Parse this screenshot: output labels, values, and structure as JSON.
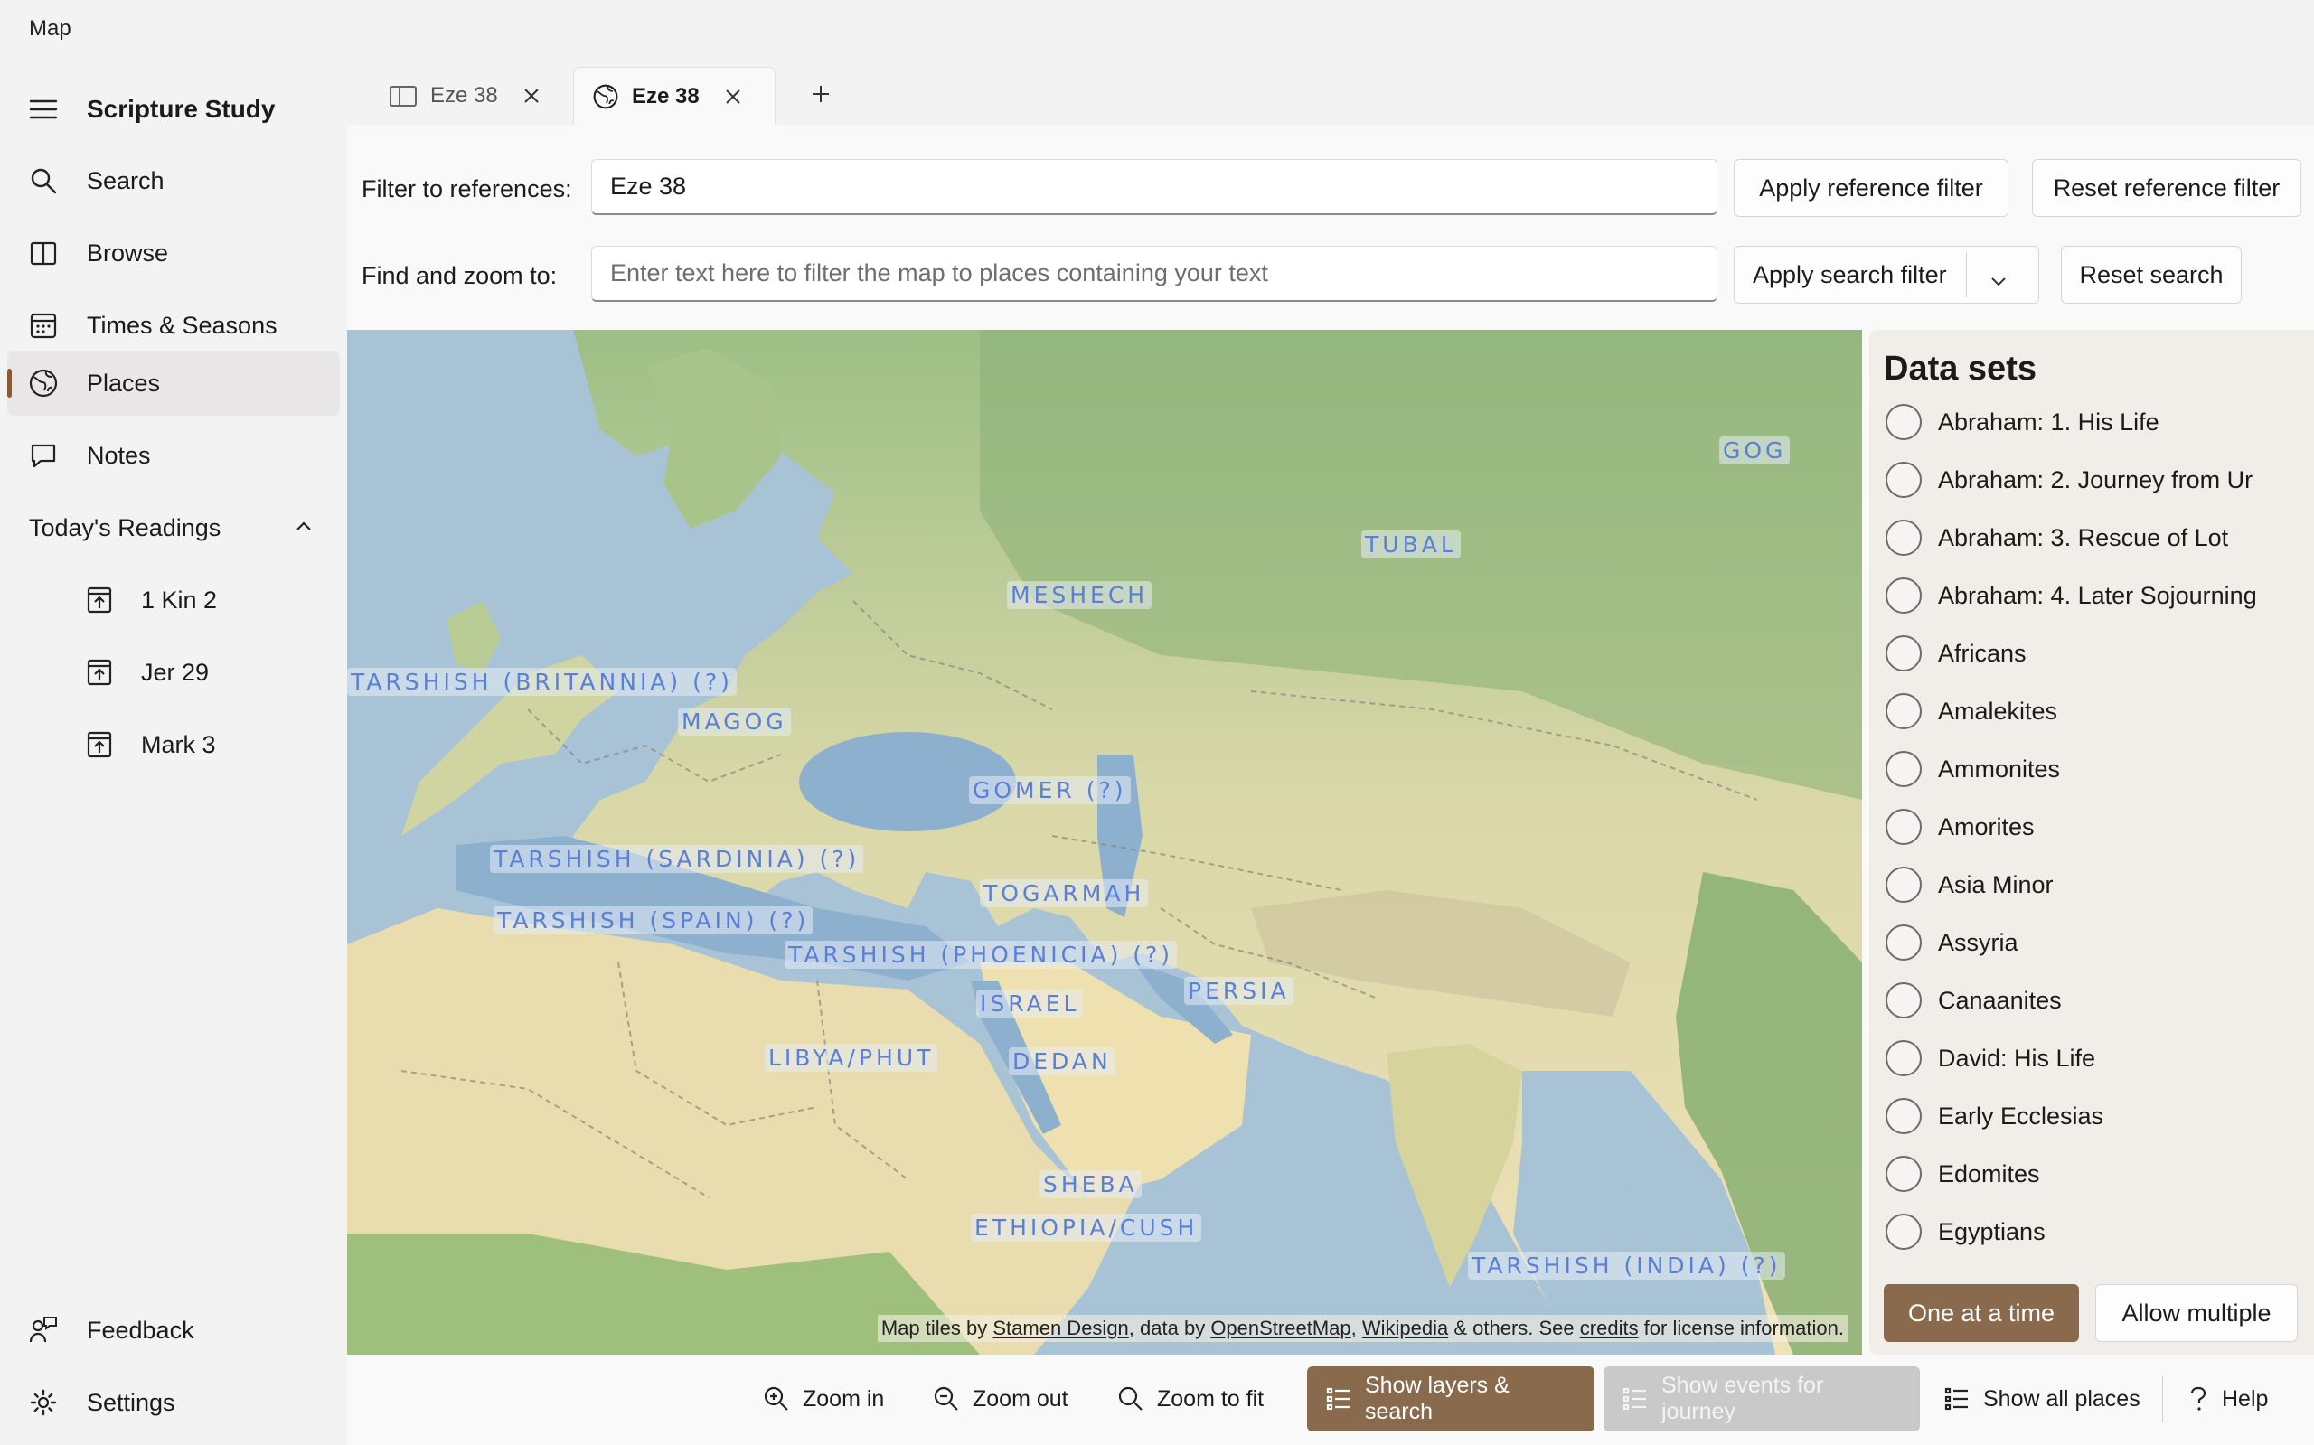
{
  "window": {
    "title": "Map"
  },
  "sidebar": {
    "app_name": "Scripture Study",
    "items": [
      {
        "label": "Search",
        "icon": "search-icon"
      },
      {
        "label": "Browse",
        "icon": "book-icon"
      },
      {
        "label": "Times & Seasons",
        "icon": "calendar-icon"
      },
      {
        "label": "Places",
        "icon": "globe-icon",
        "active": true
      },
      {
        "label": "Notes",
        "icon": "comment-icon"
      }
    ],
    "readings_header": "Today's Readings",
    "readings": [
      "1 Kin 2",
      "Jer 29",
      "Mark 3"
    ],
    "footer": [
      {
        "label": "Feedback",
        "icon": "feedback-icon"
      },
      {
        "label": "Settings",
        "icon": "gear-icon"
      }
    ]
  },
  "tabs": [
    {
      "label": "Eze 38",
      "icon": "book-icon",
      "active": false
    },
    {
      "label": "Eze 38",
      "icon": "globe-icon",
      "active": true
    }
  ],
  "filters": {
    "reference_label": "Filter to references:",
    "reference_value": "Eze 38",
    "apply_reference": "Apply reference filter",
    "reset_reference": "Reset reference filter",
    "find_label": "Find and zoom to:",
    "find_placeholder": "Enter text here to filter the map to places containing your text",
    "apply_search": "Apply search filter",
    "reset_search": "Reset search"
  },
  "map": {
    "places": [
      "GOG",
      "TUBAL",
      "MESHECH",
      "TARSHISH (BRITANNIA) (?)",
      "MAGOG",
      "GOMER (?)",
      "TARSHISH (SARDINIA) (?)",
      "TOGARMAH",
      "TARSHISH (SPAIN) (?)",
      "TARSHISH (PHOENICIA) (?)",
      "PERSIA",
      "ISRAEL",
      "LIBYA/PHUT",
      "DEDAN",
      "SHEBA",
      "ETHIOPIA/CUSH",
      "TARSHISH (INDIA) (?)"
    ],
    "attribution": {
      "prefix": "Map tiles by ",
      "stamen": "Stamen Design",
      "mid1": ", data by ",
      "osm": "OpenStreetMap",
      "comma": ", ",
      "wiki": "Wikipedia",
      "mid2": " & others. See ",
      "credits": "credits",
      "suffix": " for license information."
    }
  },
  "datasets": {
    "title": "Data sets",
    "items": [
      "Abraham: 1. His Life",
      "Abraham: 2. Journey from Ur",
      "Abraham: 3. Rescue of Lot",
      "Abraham: 4. Later Sojourning",
      "Africans",
      "Amalekites",
      "Ammonites",
      "Amorites",
      "Asia Minor",
      "Assyria",
      "Canaanites",
      "David: His Life",
      "Early Ecclesias",
      "Edomites",
      "Egyptians"
    ],
    "one_at_a_time": "One at a time",
    "allow_multiple": "Allow multiple"
  },
  "bottom_bar": {
    "zoom_in": "Zoom in",
    "zoom_out": "Zoom out",
    "zoom_fit": "Zoom to fit",
    "show_layers": "Show layers & search",
    "show_events": "Show events for journey",
    "show_all": "Show all places",
    "help": "Help"
  },
  "colors": {
    "accent": "#8a6a4c",
    "link": "#5a7fd6"
  }
}
